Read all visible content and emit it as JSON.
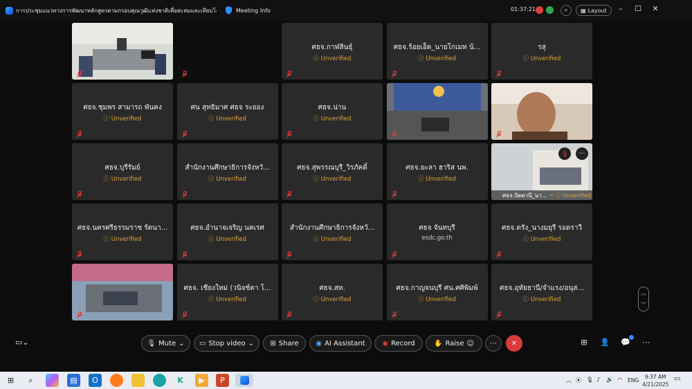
{
  "window": {
    "title": "การประชุมแนวทางการพัฒนาหลักสูตรตามกรอบคุณวุฒิแห่งชาติเพื่อสะสมและเทียบโอน...",
    "meeting_info": "Meeting Info",
    "timer": "01:37:21",
    "layout_label": "Layout"
  },
  "participants": [
    {
      "name": "",
      "status": "",
      "video": "office"
    },
    {
      "name": "",
      "status": "",
      "video": "dark"
    },
    {
      "name": "ศธจ.กาฬสินธุ์",
      "status": "Unverified"
    },
    {
      "name": "ศธจ.ร้อยเอ็ด_นายโกเมท น้...",
      "status": "Unverified"
    },
    {
      "name": "รสุ",
      "status": "Unverified"
    },
    {
      "name": "ศธจ.ชุมพร สามารถ พันคง",
      "status": "Unverified"
    },
    {
      "name": "ศน สุทธิมาศ ศธจ ระยอง",
      "status": "Unverified"
    },
    {
      "name": "ศธจ.น่าน",
      "status": "Unverified"
    },
    {
      "name": "",
      "status": "",
      "video": "room"
    },
    {
      "name": "",
      "status": "",
      "video": "man"
    },
    {
      "name": "ศธจ.บุรีรัมย์",
      "status": "Unverified"
    },
    {
      "name": "สำนักงานศึกษาธิการจังหวั...",
      "status": "Unverified"
    },
    {
      "name": "ศธจ.สุพรรณบุรี_วิรภัคดิ์",
      "status": "Unverified"
    },
    {
      "name": "ศธจ.ยะลา ฮาริส นพ.",
      "status": "Unverified"
    },
    {
      "name": "ศธจ.ปัตตานี_นา...",
      "status": "Unverified",
      "video": "doc"
    },
    {
      "name": "ศธจ.นครศรีธรรมราช รัตนา...",
      "status": "Unverified"
    },
    {
      "name": "ศธจ.อำนาจเจริญ นคเรศ",
      "status": "Unverified"
    },
    {
      "name": "สำนักงานศึกษาธิการจังหวั...",
      "status": "Unverified"
    },
    {
      "name": "ศธจ จันทบุรี",
      "status": "esdc.go.th",
      "plain": true
    },
    {
      "name": "ศธจ.ตรัง_นางมยุรี รอดราวี",
      "status": "Unverified"
    },
    {
      "name": "",
      "status": "",
      "video": "meeting"
    },
    {
      "name": "ศธจ. เชียงใหม่ (วนิจช์ตา โ...",
      "status": "Unverified"
    },
    {
      "name": "ศธจ.สท.",
      "status": "Unverified"
    },
    {
      "name": "ศธจ.กาญจนบุรี ศน.ศศิพิมพ์",
      "status": "Unverified"
    },
    {
      "name": "ศธจ.อุทัยธานี/จำแรง/อนุส...",
      "status": "Unverified"
    }
  ],
  "toolbar": {
    "mute": "Mute",
    "stop_video": "Stop video",
    "share": "Share",
    "ai_assistant": "AI Assistant",
    "record": "Record",
    "raise": "Raise"
  },
  "taskbar": {
    "lang": "ENG",
    "time": "9:37 AM",
    "date": "4/21/2025"
  },
  "colors": {
    "unverified": "#e0a53c",
    "end_button": "#d93a3a",
    "tile_bg": "#2a2a2a"
  }
}
